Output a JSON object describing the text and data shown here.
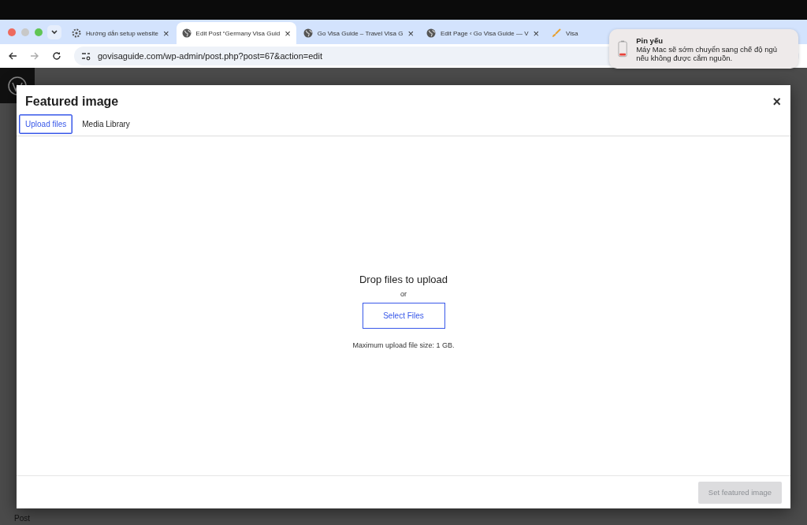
{
  "browser": {
    "tabs": [
      {
        "title": "Hướng dẫn setup website",
        "selected": false
      },
      {
        "title": "Edit Post “Germany Visa Guid",
        "selected": true
      },
      {
        "title": "Go Visa Guide – Travel Visa G",
        "selected": false
      },
      {
        "title": "Edit Page ‹ Go Visa Guide — V",
        "selected": false
      },
      {
        "title": "Visa",
        "selected": false
      }
    ],
    "close_glyph": "×",
    "address": "govisaguide.com/wp-admin/post.php?post=67&action=edit"
  },
  "notification": {
    "title": "Pin yếu",
    "message": "Máy Mac sẽ sớm chuyển sang chế độ ngủ nếu không được cắm nguồn."
  },
  "modal": {
    "title": "Featured image",
    "close_glyph": "×",
    "tabs": [
      {
        "label": "Upload files",
        "selected": true
      },
      {
        "label": "Media Library",
        "selected": false
      }
    ],
    "drop_title": "Drop files to upload",
    "or": "or",
    "select_button": "Select Files",
    "max_size": "Maximum upload file size: 1 GB.",
    "primary_button": {
      "label": "Set featured image",
      "disabled": true
    }
  },
  "editor": {
    "footer_label": "Post"
  }
}
